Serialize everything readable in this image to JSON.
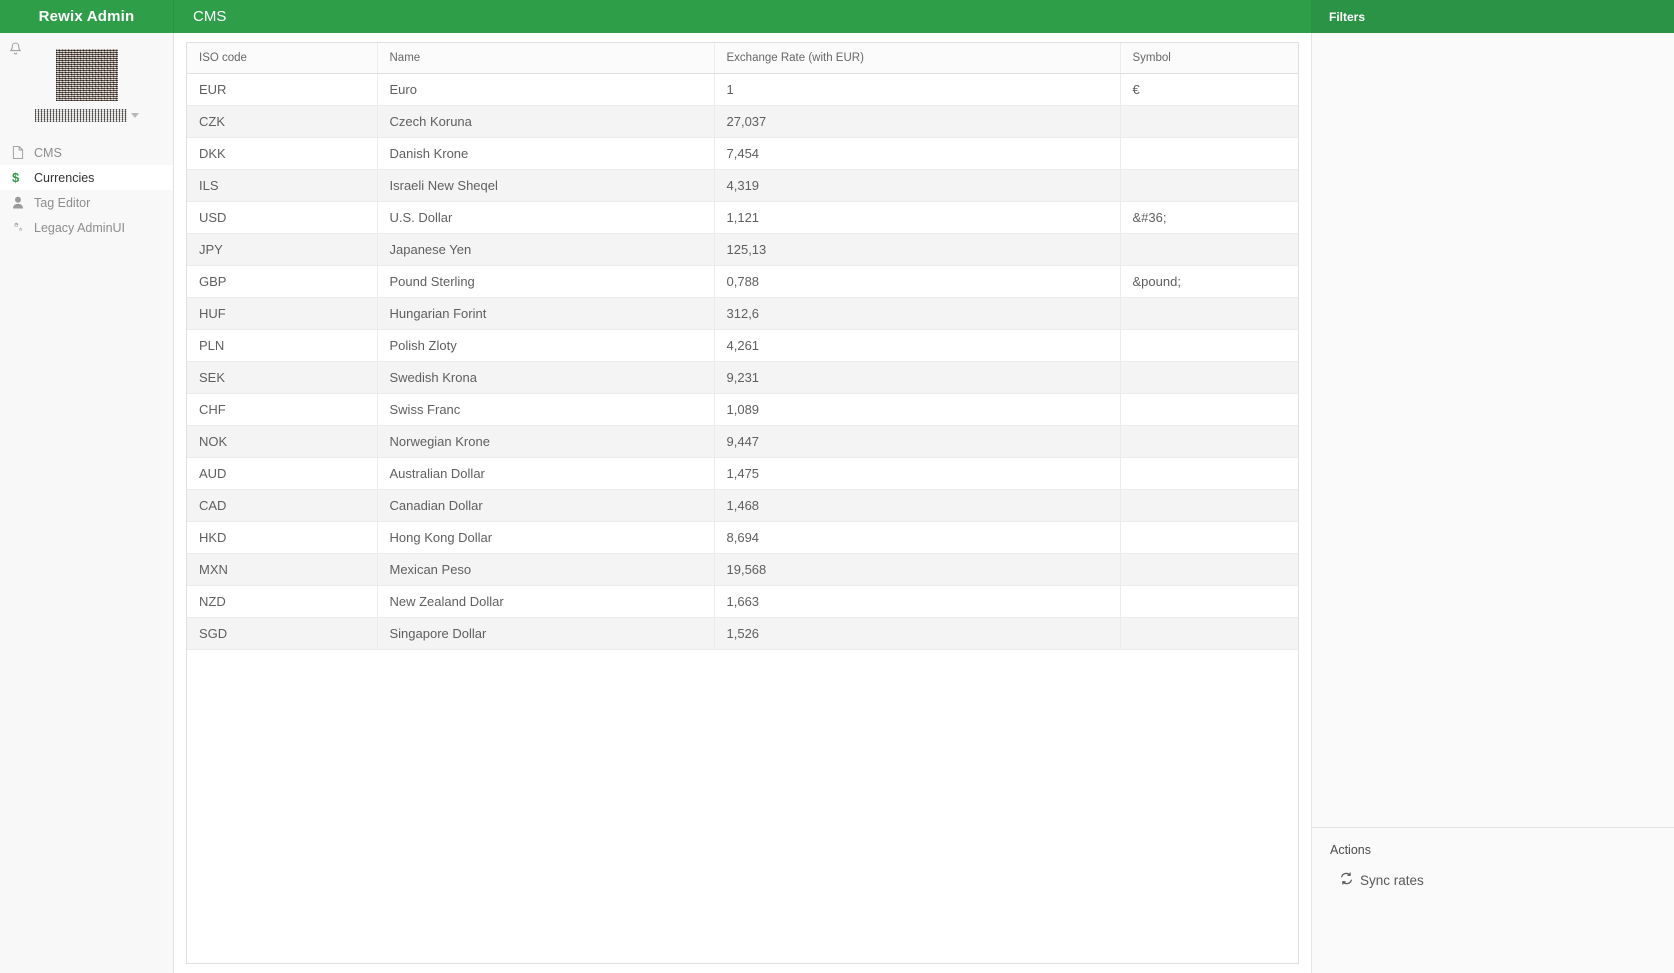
{
  "topbar": {
    "brand": "Rewix Admin",
    "section_title": "CMS",
    "filters_label": "Filters"
  },
  "sidebar": {
    "bell_icon": "bell-icon",
    "profile": {
      "avatar": "avatar-image-redacted",
      "username": "",
      "caret": "chevron-down-icon"
    },
    "items": [
      {
        "label": "CMS",
        "icon": "file-icon",
        "active": false
      },
      {
        "label": "Currencies",
        "icon": "dollar-icon",
        "active": true
      },
      {
        "label": "Tag Editor",
        "icon": "user-icon",
        "active": false
      },
      {
        "label": "Legacy AdminUI",
        "icon": "cogs-icon",
        "active": false
      }
    ]
  },
  "table": {
    "columns": [
      "ISO code",
      "Name",
      "Exchange Rate (with EUR)",
      "Symbol"
    ],
    "rows": [
      {
        "iso": "EUR",
        "name": "Euro",
        "rate": "1",
        "symbol": "€"
      },
      {
        "iso": "CZK",
        "name": "Czech Koruna",
        "rate": "27,037",
        "symbol": ""
      },
      {
        "iso": "DKK",
        "name": "Danish Krone",
        "rate": "7,454",
        "symbol": ""
      },
      {
        "iso": "ILS",
        "name": "Israeli New Sheqel",
        "rate": "4,319",
        "symbol": ""
      },
      {
        "iso": "USD",
        "name": "U.S. Dollar",
        "rate": "1,121",
        "symbol": "&#36;"
      },
      {
        "iso": "JPY",
        "name": "Japanese Yen",
        "rate": "125,13",
        "symbol": ""
      },
      {
        "iso": "GBP",
        "name": "Pound Sterling",
        "rate": "0,788",
        "symbol": "&pound;"
      },
      {
        "iso": "HUF",
        "name": "Hungarian Forint",
        "rate": "312,6",
        "symbol": ""
      },
      {
        "iso": "PLN",
        "name": "Polish Zloty",
        "rate": "4,261",
        "symbol": ""
      },
      {
        "iso": "SEK",
        "name": "Swedish Krona",
        "rate": "9,231",
        "symbol": ""
      },
      {
        "iso": "CHF",
        "name": "Swiss Franc",
        "rate": "1,089",
        "symbol": ""
      },
      {
        "iso": "NOK",
        "name": "Norwegian Krone",
        "rate": "9,447",
        "symbol": ""
      },
      {
        "iso": "AUD",
        "name": "Australian Dollar",
        "rate": "1,475",
        "symbol": ""
      },
      {
        "iso": "CAD",
        "name": "Canadian Dollar",
        "rate": "1,468",
        "symbol": ""
      },
      {
        "iso": "HKD",
        "name": "Hong Kong Dollar",
        "rate": "8,694",
        "symbol": ""
      },
      {
        "iso": "MXN",
        "name": "Mexican Peso",
        "rate": "19,568",
        "symbol": ""
      },
      {
        "iso": "NZD",
        "name": "New Zealand Dollar",
        "rate": "1,663",
        "symbol": ""
      },
      {
        "iso": "SGD",
        "name": "Singapore Dollar",
        "rate": "1,526",
        "symbol": ""
      }
    ]
  },
  "rightpanel": {
    "actions_title": "Actions",
    "actions": [
      {
        "label": "Sync rates",
        "icon": "sync-icon"
      }
    ]
  },
  "colors": {
    "brand_green": "#2e9e49",
    "panel_green": "#2b9345",
    "active_accent": "#2e9e49",
    "row_alt": "#f4f4f4",
    "border": "#e0e0e0"
  }
}
